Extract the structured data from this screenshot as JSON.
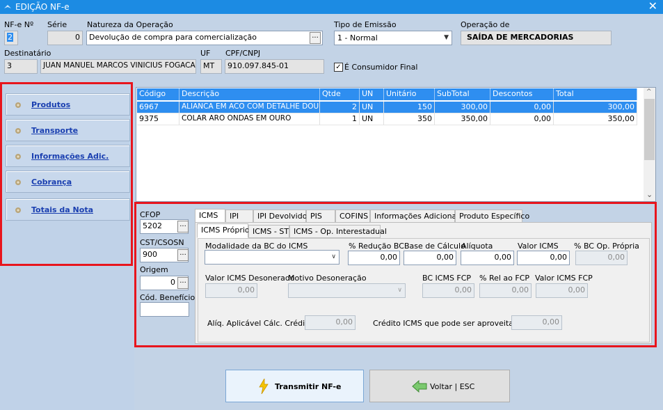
{
  "window": {
    "title": "EDIÇÃO NF-e",
    "close_icon": "close-icon"
  },
  "header": {
    "nfe_label": "NF-e Nº",
    "nfe_value": "2",
    "serie_label": "Série",
    "serie_value": "0",
    "natureza_label": "Natureza da Operação",
    "natureza_value": "Devolução de compra para comercialização",
    "tipo_label": "Tipo de Emissão",
    "tipo_value": "1 - Normal",
    "operacao_label": "Operação de",
    "operacao_value": "SAÍDA DE MERCADORIAS",
    "dest_label": "Destinatário",
    "dest_code": "3",
    "dest_name": "JUAN MANUEL MARCOS VINICIUS FOGACA",
    "uf_label": "UF",
    "uf_value": "MT",
    "cpf_label": "CPF/CNPJ",
    "cpf_value": "910.097.845-01",
    "consumidor_label": "É Consumidor Final",
    "consumidor_checked": "✓",
    "ellipsis": "..."
  },
  "sidebar": {
    "items": [
      {
        "label": "Produtos"
      },
      {
        "label": "Transporte"
      },
      {
        "label": "Informações Adic."
      },
      {
        "label": "Cobrança"
      },
      {
        "label": "Totais da Nota"
      }
    ]
  },
  "grid": {
    "columns": [
      "Código",
      "Descrição",
      "Qtde",
      "UN",
      "Unitário",
      "SubTotal",
      "Descontos",
      "Total"
    ],
    "rows": [
      [
        "6967",
        "ALIANCA EM ACO COM DETALHE DOURA",
        "2",
        "UN",
        "150",
        "300,00",
        "0,00",
        "300,00"
      ],
      [
        "9375",
        "COLAR ARO ONDAS EM OURO",
        "1",
        "UN",
        "350",
        "350,00",
        "0,00",
        "350,00"
      ]
    ],
    "scroll_up": "^",
    "scroll_down": "⌄"
  },
  "item": {
    "cfop_label": "CFOP",
    "cfop_value": "5202",
    "cst_label": "CST/CSOSN",
    "cst_value": "900",
    "origem_label": "Origem",
    "origem_value": "0",
    "beneficio_label": "Cód. Benefício",
    "beneficio_value": ""
  },
  "tabs": [
    "ICMS",
    "IPI",
    "IPI Devolvido",
    "PIS",
    "COFINS",
    "Informações Adicionais",
    "Produto Específico"
  ],
  "subtabs": [
    "ICMS Próprio",
    "ICMS - ST",
    "ICMS - Op. Interestadual"
  ],
  "icms": {
    "modalidade_label": "Modalidade da BC do ICMS",
    "modalidade_value": "",
    "reducao_label": "% Redução BC",
    "reducao_value": "0,00",
    "base_label": "Base de Cálculo",
    "base_value": "0,00",
    "aliquota_label": "Alíquota",
    "aliquota_value": "0,00",
    "valor_label": "Valor ICMS",
    "valor_value": "0,00",
    "bcop_label": "% BC Op. Própria",
    "bcop_value": "0,00",
    "deson_label": "Valor ICMS Desonerado",
    "deson_value": "0,00",
    "motivo_label": "Motivo Desoneração",
    "motivo_value": "",
    "bcfcp_label": "BC ICMS FCP",
    "bcfcp_value": "0,00",
    "relfcp_label": "% Rel ao FCP",
    "relfcp_value": "0,00",
    "valfcp_label": "Valor ICMS FCP",
    "valfcp_value": "0,00",
    "aliqcred_label": "Alíq. Aplicável Cálc. Crédito:",
    "aliqcred_value": "0,00",
    "credito_label": "Crédito ICMS que pode ser aproveitado:",
    "credito_value": "0,00"
  },
  "footer": {
    "transmit_label": "Transmitir NF-e",
    "back_label": "Voltar | ESC"
  },
  "colors": {
    "titlebar": "#1c8be3",
    "selection": "#2e8ef0",
    "highlight": "#e8151d",
    "background": "#c3d3e6"
  }
}
